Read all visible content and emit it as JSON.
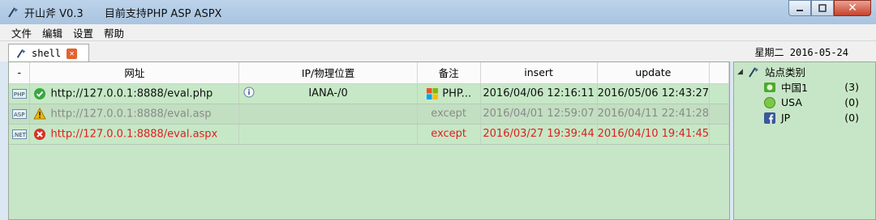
{
  "window": {
    "title_app": "开山斧 V0.3",
    "title_desc": "目前支持PHP ASP ASPX"
  },
  "menu": [
    "文件",
    "编辑",
    "设置",
    "帮助"
  ],
  "tab": {
    "label": "shell"
  },
  "date": "星期二 2016-05-24",
  "table": {
    "headers": [
      "-",
      "网址",
      "IP/物理位置",
      "备注",
      "insert",
      "update"
    ],
    "rows": [
      {
        "type": "PHP",
        "status": "ok",
        "url": "http://127.0.0.1:8888/eval.php",
        "ip": "IANA-/0",
        "note": "PHP...",
        "insert": "2016/04/06 12:16:11",
        "update": "2016/05/06 12:43:27"
      },
      {
        "type": "ASP",
        "status": "warning",
        "url": "http://127.0.0.1:8888/eval.asp",
        "ip": "",
        "note": "except",
        "insert": "2016/04/01 12:59:07",
        "update": "2016/04/11 22:41:28"
      },
      {
        "type": ".NET",
        "status": "error",
        "url": "http://127.0.0.1:8888/eval.aspx",
        "ip": "",
        "note": "except",
        "insert": "2016/03/27 19:39:44",
        "update": "2016/04/10 19:41:45"
      }
    ]
  },
  "tree": {
    "root": "站点类别",
    "items": [
      {
        "label": "中国1",
        "count": "(3)",
        "icon": "china-flag-icon"
      },
      {
        "label": "USA",
        "count": "(0)",
        "icon": "green-circle-icon"
      },
      {
        "label": "JP",
        "count": "(0)",
        "icon": "facebook-icon"
      }
    ]
  },
  "colors": {
    "row_bg": "#c6e8c6",
    "error_text": "#e11d1d",
    "warning_text": "#8a8a8a"
  }
}
